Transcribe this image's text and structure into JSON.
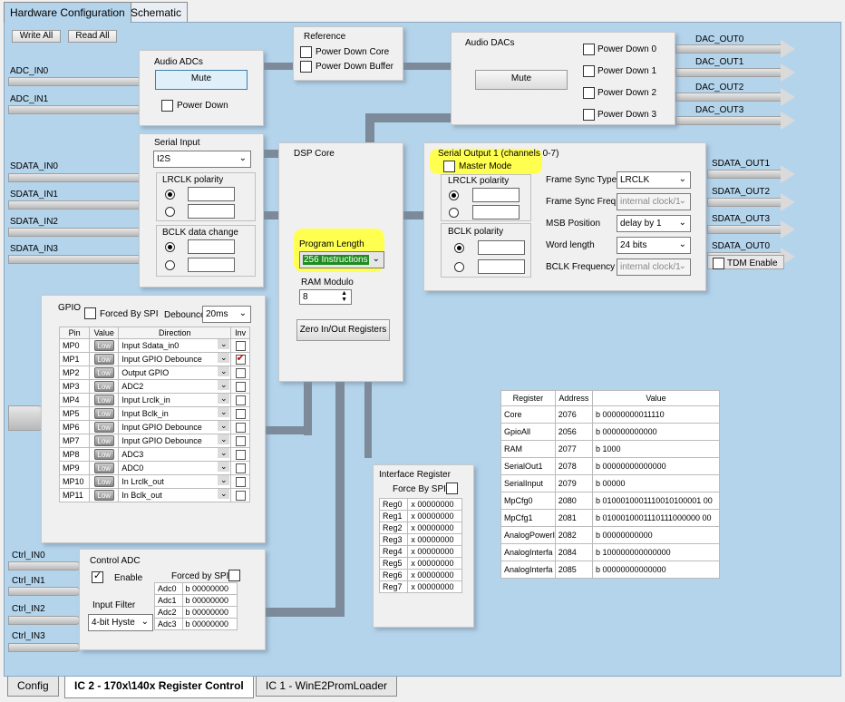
{
  "tabs_top": [
    "Hardware Configuration",
    "Schematic"
  ],
  "tabs_bottom": [
    "Config",
    "IC 2 - 170x\\140x Register Control",
    "IC 1 - WinE2PromLoader"
  ],
  "toolbar": {
    "write_all": "Write All",
    "read_all": "Read All"
  },
  "inputs_left": [
    "ADC_IN0",
    "ADC_IN1",
    "SDATA_IN0",
    "SDATA_IN1",
    "SDATA_IN2",
    "SDATA_IN3",
    "Ctrl_IN0",
    "Ctrl_IN1",
    "Ctrl_IN2",
    "Ctrl_IN3"
  ],
  "outputs_right": [
    "DAC_OUT0",
    "DAC_OUT1",
    "DAC_OUT2",
    "DAC_OUT3",
    "SDATA_OUT1",
    "SDATA_OUT2",
    "SDATA_OUT3",
    "SDATA_OUT0"
  ],
  "audio_adcs": {
    "title": "Audio ADCs",
    "mute": "Mute",
    "power_down": "Power Down"
  },
  "reference": {
    "title": "Reference",
    "pdc": "Power Down Core",
    "pdb": "Power Down Buffer"
  },
  "audio_dacs": {
    "title": "Audio DACs",
    "mute": "Mute",
    "pd": [
      "Power Down 0",
      "Power Down 1",
      "Power Down 2",
      "Power Down 3"
    ]
  },
  "serial_input": {
    "title": "Serial Input",
    "format": "I2S",
    "lrclk": "LRCLK polarity",
    "bclk": "BCLK data change"
  },
  "dsp": {
    "title": "DSP Core",
    "prog_len": "Program Length",
    "prog_val": "256 Instructions",
    "ram_mod": "RAM Modulo",
    "ram_val": "8",
    "zero": "Zero In/Out Registers"
  },
  "serial_output": {
    "title": "Serial Output 1 (channels 0-7)",
    "master": "Master Mode",
    "lrclk": "LRCLK polarity",
    "bclk": "BCLK polarity",
    "fields": [
      {
        "label": "Frame Sync Type",
        "value": "LRCLK",
        "disabled": false
      },
      {
        "label": "Frame Sync Freq.",
        "value": "internal clock/1",
        "disabled": true
      },
      {
        "label": "MSB Position",
        "value": "delay by 1",
        "disabled": false
      },
      {
        "label": "Word length",
        "value": "24 bits",
        "disabled": false
      },
      {
        "label": "BCLK Frequency",
        "value": "internal clock/1",
        "disabled": true
      }
    ],
    "tdm": "TDM Enable"
  },
  "gpio": {
    "title": "GPIO",
    "forced": "Forced By SPI",
    "debounce": "Debounce",
    "debounce_val": "20ms",
    "headers": [
      "Pin",
      "Value",
      "Direction",
      "Inv"
    ],
    "low": "Low",
    "rows": [
      [
        "MP0",
        "Input  Sdata_in0"
      ],
      [
        "MP1",
        "Input  GPIO Debounce"
      ],
      [
        "MP2",
        "Output GPIO"
      ],
      [
        "MP3",
        "ADC2"
      ],
      [
        "MP4",
        "Input  Lrclk_in"
      ],
      [
        "MP5",
        "Input  Bclk_in"
      ],
      [
        "MP6",
        "Input  GPIO Debounce"
      ],
      [
        "MP7",
        "Input  GPIO Debounce"
      ],
      [
        "MP8",
        "ADC3"
      ],
      [
        "MP9",
        "ADC0"
      ],
      [
        "MP10",
        "In Lrclk_out"
      ],
      [
        "MP11",
        "In Bclk_out"
      ]
    ]
  },
  "control_adc": {
    "title": "Control ADC",
    "enable": "Enable",
    "forced": "Forced by SPI",
    "filter": "Input Filter",
    "filter_val": "4-bit Hyste",
    "rows": [
      [
        "Adc0",
        "b 00000000"
      ],
      [
        "Adc1",
        "b 00000000"
      ],
      [
        "Adc2",
        "b 00000000"
      ],
      [
        "Adc3",
        "b 00000000"
      ]
    ]
  },
  "interface": {
    "title": "Interface Register",
    "force": "Force By SPI",
    "rows": [
      [
        "Reg0",
        "x 00000000"
      ],
      [
        "Reg1",
        "x 00000000"
      ],
      [
        "Reg2",
        "x 00000000"
      ],
      [
        "Reg3",
        "x 00000000"
      ],
      [
        "Reg4",
        "x 00000000"
      ],
      [
        "Reg5",
        "x 00000000"
      ],
      [
        "Reg6",
        "x 00000000"
      ],
      [
        "Reg7",
        "x 00000000"
      ]
    ]
  },
  "registers": {
    "headers": [
      "Register",
      "Address",
      "Value"
    ],
    "rows": [
      [
        "Core",
        "2076",
        "b 00000000011110"
      ],
      [
        "GpioAll",
        "2056",
        "b 000000000000"
      ],
      [
        "RAM",
        "2077",
        "b 1000"
      ],
      [
        "SerialOut1",
        "2078",
        "b 00000000000000"
      ],
      [
        "SerialInput",
        "2079",
        "b 00000"
      ],
      [
        "MpCfg0",
        "2080",
        "b 0100010001110010100001 00"
      ],
      [
        "MpCfg1",
        "2081",
        "b 0100010001110111000000 00"
      ],
      [
        "AnalogPowerI",
        "2082",
        "b 00000000000"
      ],
      [
        "AnalogInterfa",
        "2084",
        "b 100000000000000"
      ],
      [
        "AnalogInterfa",
        "2085",
        "b 00000000000000"
      ]
    ]
  }
}
